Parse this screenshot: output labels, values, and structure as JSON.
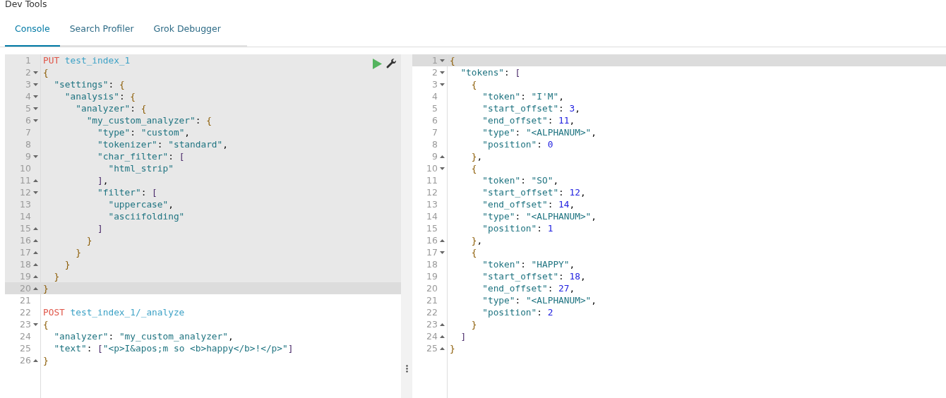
{
  "title": "Dev Tools",
  "tabs": [
    {
      "label": "Console",
      "selected": true
    },
    {
      "label": "Search Profiler",
      "selected": false
    },
    {
      "label": "Grok Debugger",
      "selected": false
    }
  ],
  "request_editor": {
    "requests": [
      {
        "selected": true,
        "lines": [
          {
            "number": "1",
            "kind": "plain",
            "active": false,
            "parts": [
              {
                "kind": "method",
                "text": "PUT "
              },
              {
                "kind": "url",
                "text": "test_index_1"
              }
            ]
          },
          {
            "number": "2",
            "kind": "fold_start",
            "active": false,
            "parts": [
              {
                "kind": "brace",
                "text": "{"
              }
            ]
          },
          {
            "number": "3",
            "kind": "fold_start",
            "active": false,
            "parts": [
              {
                "kind": "key",
                "text": "  \"settings\""
              },
              {
                "kind": "plain",
                "text": ": "
              },
              {
                "kind": "brace",
                "text": "{"
              }
            ]
          },
          {
            "number": "4",
            "kind": "fold_start",
            "active": false,
            "parts": [
              {
                "kind": "key",
                "text": "    \"analysis\""
              },
              {
                "kind": "plain",
                "text": ": "
              },
              {
                "kind": "brace",
                "text": "{"
              }
            ]
          },
          {
            "number": "5",
            "kind": "fold_start",
            "active": false,
            "parts": [
              {
                "kind": "key",
                "text": "      \"analyzer\""
              },
              {
                "kind": "plain",
                "text": ": "
              },
              {
                "kind": "brace",
                "text": "{"
              }
            ]
          },
          {
            "number": "6",
            "kind": "fold_start",
            "active": false,
            "parts": [
              {
                "kind": "key",
                "text": "        \"my_custom_analyzer\""
              },
              {
                "kind": "plain",
                "text": ": "
              },
              {
                "kind": "brace",
                "text": "{"
              }
            ]
          },
          {
            "number": "7",
            "kind": "plain",
            "active": false,
            "parts": [
              {
                "kind": "key",
                "text": "          \"type\""
              },
              {
                "kind": "plain",
                "text": ": "
              },
              {
                "kind": "string",
                "text": "\"custom\""
              },
              {
                "kind": "plain",
                "text": ","
              }
            ]
          },
          {
            "number": "8",
            "kind": "plain",
            "active": false,
            "parts": [
              {
                "kind": "key",
                "text": "          \"tokenizer\""
              },
              {
                "kind": "plain",
                "text": ": "
              },
              {
                "kind": "string",
                "text": "\"standard\""
              },
              {
                "kind": "plain",
                "text": ","
              }
            ]
          },
          {
            "number": "9",
            "kind": "fold_start",
            "active": false,
            "parts": [
              {
                "kind": "key",
                "text": "          \"char_filter\""
              },
              {
                "kind": "plain",
                "text": ": "
              },
              {
                "kind": "bracket",
                "text": "["
              }
            ]
          },
          {
            "number": "10",
            "kind": "plain",
            "active": false,
            "parts": [
              {
                "kind": "string",
                "text": "            \"html_strip\""
              }
            ]
          },
          {
            "number": "11",
            "kind": "fold_end",
            "active": false,
            "parts": [
              {
                "kind": "bracket",
                "text": "          ]"
              },
              {
                "kind": "plain",
                "text": ","
              }
            ]
          },
          {
            "number": "12",
            "kind": "fold_start",
            "active": false,
            "parts": [
              {
                "kind": "key",
                "text": "          \"filter\""
              },
              {
                "kind": "plain",
                "text": ": "
              },
              {
                "kind": "bracket",
                "text": "["
              }
            ]
          },
          {
            "number": "13",
            "kind": "plain",
            "active": false,
            "parts": [
              {
                "kind": "string",
                "text": "            \"uppercase\""
              },
              {
                "kind": "plain",
                "text": ","
              }
            ]
          },
          {
            "number": "14",
            "kind": "plain",
            "active": false,
            "parts": [
              {
                "kind": "string",
                "text": "            \"asciifolding\""
              }
            ]
          },
          {
            "number": "15",
            "kind": "fold_end",
            "active": false,
            "parts": [
              {
                "kind": "bracket",
                "text": "          ]"
              }
            ]
          },
          {
            "number": "16",
            "kind": "fold_end",
            "active": false,
            "parts": [
              {
                "kind": "brace",
                "text": "        }"
              }
            ]
          },
          {
            "number": "17",
            "kind": "fold_end",
            "active": false,
            "parts": [
              {
                "kind": "brace",
                "text": "      }"
              }
            ]
          },
          {
            "number": "18",
            "kind": "fold_end",
            "active": false,
            "parts": [
              {
                "kind": "brace",
                "text": "    }"
              }
            ]
          },
          {
            "number": "19",
            "kind": "fold_end",
            "active": false,
            "parts": [
              {
                "kind": "brace",
                "text": "  }"
              }
            ]
          },
          {
            "number": "20",
            "kind": "fold_end",
            "active": true,
            "parts": [
              {
                "kind": "brace",
                "text": "}"
              }
            ]
          }
        ]
      },
      {
        "selected": false,
        "lines": [
          {
            "number": "21",
            "kind": "plain",
            "active": false
          },
          {
            "number": "22",
            "kind": "plain",
            "active": false,
            "parts": [
              {
                "kind": "method",
                "text": "POST "
              },
              {
                "kind": "url",
                "text": "test_index_1/_analyze"
              }
            ]
          },
          {
            "number": "23",
            "kind": "fold_start",
            "active": false,
            "parts": [
              {
                "kind": "brace",
                "text": "{"
              }
            ]
          },
          {
            "number": "24",
            "kind": "plain",
            "active": false,
            "parts": [
              {
                "kind": "key",
                "text": "  \"analyzer\""
              },
              {
                "kind": "plain",
                "text": ": "
              },
              {
                "kind": "string",
                "text": "\"my_custom_analyzer\""
              },
              {
                "kind": "plain",
                "text": ","
              }
            ]
          },
          {
            "number": "25",
            "kind": "plain",
            "active": false,
            "parts": [
              {
                "kind": "key",
                "text": "  \"text\""
              },
              {
                "kind": "plain",
                "text": ": "
              },
              {
                "kind": "bracket",
                "text": "["
              },
              {
                "kind": "string",
                "text": "\"<p>I&apos;m so <b>happy</b>!</p>\""
              },
              {
                "kind": "bracket",
                "text": "]"
              }
            ]
          },
          {
            "number": "26",
            "kind": "fold_end",
            "active": false,
            "parts": [
              {
                "kind": "brace",
                "text": "}"
              }
            ]
          }
        ]
      }
    ]
  },
  "response_viewer": {
    "lines": [
      {
        "number": "1",
        "kind": "fold_start",
        "active": true,
        "parts": [
          {
            "kind": "brace",
            "text": "{"
          }
        ]
      },
      {
        "number": "2",
        "kind": "fold_start",
        "active": false,
        "parts": [
          {
            "kind": "key",
            "text": "  \"tokens\""
          },
          {
            "kind": "plain",
            "text": ": "
          },
          {
            "kind": "bracket",
            "text": "["
          }
        ]
      },
      {
        "number": "3",
        "kind": "fold_start",
        "active": false,
        "parts": [
          {
            "kind": "brace",
            "text": "    {"
          }
        ]
      },
      {
        "number": "4",
        "kind": "plain",
        "active": false,
        "parts": [
          {
            "kind": "key",
            "text": "      \"token\""
          },
          {
            "kind": "plain",
            "text": ": "
          },
          {
            "kind": "string",
            "text": "\"I'M\""
          },
          {
            "kind": "plain",
            "text": ","
          }
        ]
      },
      {
        "number": "5",
        "kind": "plain",
        "active": false,
        "parts": [
          {
            "kind": "key",
            "text": "      \"start_offset\""
          },
          {
            "kind": "plain",
            "text": ": "
          },
          {
            "kind": "number",
            "text": "3"
          },
          {
            "kind": "plain",
            "text": ","
          }
        ]
      },
      {
        "number": "6",
        "kind": "plain",
        "active": false,
        "parts": [
          {
            "kind": "key",
            "text": "      \"end_offset\""
          },
          {
            "kind": "plain",
            "text": ": "
          },
          {
            "kind": "number",
            "text": "11"
          },
          {
            "kind": "plain",
            "text": ","
          }
        ]
      },
      {
        "number": "7",
        "kind": "plain",
        "active": false,
        "parts": [
          {
            "kind": "key",
            "text": "      \"type\""
          },
          {
            "kind": "plain",
            "text": ": "
          },
          {
            "kind": "string",
            "text": "\"<ALPHANUM>\""
          },
          {
            "kind": "plain",
            "text": ","
          }
        ]
      },
      {
        "number": "8",
        "kind": "plain",
        "active": false,
        "parts": [
          {
            "kind": "key",
            "text": "      \"position\""
          },
          {
            "kind": "plain",
            "text": ": "
          },
          {
            "kind": "number",
            "text": "0"
          }
        ]
      },
      {
        "number": "9",
        "kind": "fold_end",
        "active": false,
        "parts": [
          {
            "kind": "brace",
            "text": "    }"
          },
          {
            "kind": "plain",
            "text": ","
          }
        ]
      },
      {
        "number": "10",
        "kind": "fold_start",
        "active": false,
        "parts": [
          {
            "kind": "brace",
            "text": "    {"
          }
        ]
      },
      {
        "number": "11",
        "kind": "plain",
        "active": false,
        "parts": [
          {
            "kind": "key",
            "text": "      \"token\""
          },
          {
            "kind": "plain",
            "text": ": "
          },
          {
            "kind": "string",
            "text": "\"SO\""
          },
          {
            "kind": "plain",
            "text": ","
          }
        ]
      },
      {
        "number": "12",
        "kind": "plain",
        "active": false,
        "parts": [
          {
            "kind": "key",
            "text": "      \"start_offset\""
          },
          {
            "kind": "plain",
            "text": ": "
          },
          {
            "kind": "number",
            "text": "12"
          },
          {
            "kind": "plain",
            "text": ","
          }
        ]
      },
      {
        "number": "13",
        "kind": "plain",
        "active": false,
        "parts": [
          {
            "kind": "key",
            "text": "      \"end_offset\""
          },
          {
            "kind": "plain",
            "text": ": "
          },
          {
            "kind": "number",
            "text": "14"
          },
          {
            "kind": "plain",
            "text": ","
          }
        ]
      },
      {
        "number": "14",
        "kind": "plain",
        "active": false,
        "parts": [
          {
            "kind": "key",
            "text": "      \"type\""
          },
          {
            "kind": "plain",
            "text": ": "
          },
          {
            "kind": "string",
            "text": "\"<ALPHANUM>\""
          },
          {
            "kind": "plain",
            "text": ","
          }
        ]
      },
      {
        "number": "15",
        "kind": "plain",
        "active": false,
        "parts": [
          {
            "kind": "key",
            "text": "      \"position\""
          },
          {
            "kind": "plain",
            "text": ": "
          },
          {
            "kind": "number",
            "text": "1"
          }
        ]
      },
      {
        "number": "16",
        "kind": "fold_end",
        "active": false,
        "parts": [
          {
            "kind": "brace",
            "text": "    }"
          },
          {
            "kind": "plain",
            "text": ","
          }
        ]
      },
      {
        "number": "17",
        "kind": "fold_start",
        "active": false,
        "parts": [
          {
            "kind": "brace",
            "text": "    {"
          }
        ]
      },
      {
        "number": "18",
        "kind": "plain",
        "active": false,
        "parts": [
          {
            "kind": "key",
            "text": "      \"token\""
          },
          {
            "kind": "plain",
            "text": ": "
          },
          {
            "kind": "string",
            "text": "\"HAPPY\""
          },
          {
            "kind": "plain",
            "text": ","
          }
        ]
      },
      {
        "number": "19",
        "kind": "plain",
        "active": false,
        "parts": [
          {
            "kind": "key",
            "text": "      \"start_offset\""
          },
          {
            "kind": "plain",
            "text": ": "
          },
          {
            "kind": "number",
            "text": "18"
          },
          {
            "kind": "plain",
            "text": ","
          }
        ]
      },
      {
        "number": "20",
        "kind": "plain",
        "active": false,
        "parts": [
          {
            "kind": "key",
            "text": "      \"end_offset\""
          },
          {
            "kind": "plain",
            "text": ": "
          },
          {
            "kind": "number",
            "text": "27"
          },
          {
            "kind": "plain",
            "text": ","
          }
        ]
      },
      {
        "number": "21",
        "kind": "plain",
        "active": false,
        "parts": [
          {
            "kind": "key",
            "text": "      \"type\""
          },
          {
            "kind": "plain",
            "text": ": "
          },
          {
            "kind": "string",
            "text": "\"<ALPHANUM>\""
          },
          {
            "kind": "plain",
            "text": ","
          }
        ]
      },
      {
        "number": "22",
        "kind": "plain",
        "active": false,
        "parts": [
          {
            "kind": "key",
            "text": "      \"position\""
          },
          {
            "kind": "plain",
            "text": ": "
          },
          {
            "kind": "number",
            "text": "2"
          }
        ]
      },
      {
        "number": "23",
        "kind": "fold_end",
        "active": false,
        "parts": [
          {
            "kind": "brace",
            "text": "    }"
          }
        ]
      },
      {
        "number": "24",
        "kind": "fold_end",
        "active": false,
        "parts": [
          {
            "kind": "bracket",
            "text": "  ]"
          }
        ]
      },
      {
        "number": "25",
        "kind": "fold_end",
        "active": false,
        "parts": [
          {
            "kind": "brace",
            "text": "}"
          }
        ]
      }
    ]
  }
}
